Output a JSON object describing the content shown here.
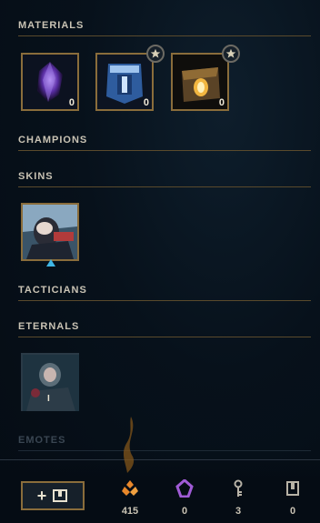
{
  "sections": {
    "materials": "MATERIALS",
    "champions": "CHAMPIONS",
    "skins": "SKINS",
    "tacticians": "TACTICIANS",
    "eternals": "ETERNALS",
    "emotes": "EMOTES"
  },
  "materials": [
    {
      "icon": "mythic-essence-crystal-icon",
      "count": "0"
    },
    {
      "icon": "masterwork-chest-icon",
      "count": "0",
      "badge": "star-icon"
    },
    {
      "icon": "hextech-chest-icon",
      "count": "0",
      "badge": "star-icon"
    }
  ],
  "skins": [
    {
      "icon": "skin-shard-icon",
      "marker": "triangle-marker-icon"
    }
  ],
  "eternals": [
    {
      "icon": "eternal-series-icon",
      "level": "I"
    }
  ],
  "currencies": [
    {
      "icon": "orange-essence-icon",
      "value": "415",
      "color": "#e8872a"
    },
    {
      "icon": "mythic-essence-icon",
      "value": "0",
      "color": "#a05bd6"
    },
    {
      "icon": "key-icon",
      "value": "3",
      "color": "#b7b2a6"
    },
    {
      "icon": "key-fragment-icon",
      "value": "0",
      "color": "#b7b2a6"
    }
  ],
  "add_button": {
    "plus": "+",
    "icon": "chest-icon"
  },
  "colors": {
    "gold": "#8a6d3b",
    "text": "#c9c3b4",
    "background": "#07111b"
  }
}
